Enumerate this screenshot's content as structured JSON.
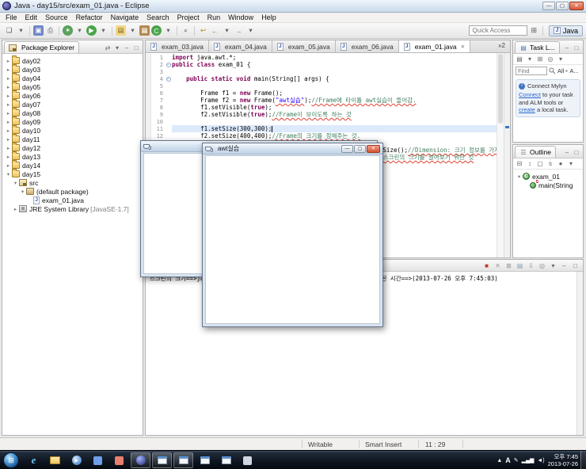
{
  "titlebar": {
    "title": "Java - day15/src/exam_01.java - Eclipse"
  },
  "menu": [
    "File",
    "Edit",
    "Source",
    "Refactor",
    "Navigate",
    "Search",
    "Project",
    "Run",
    "Window",
    "Help"
  ],
  "toolbar": {
    "quick_access_placeholder": "Quick Access",
    "perspective_label": "Java",
    "icons": [
      {
        "name": "new-wizard-icon",
        "glyph": "❏",
        "fg": "#555"
      },
      {
        "name": "new-dropdown-icon",
        "glyph": "▾",
        "fg": "#666"
      },
      {
        "sep": true
      },
      {
        "name": "save-icon",
        "glyph": "▣",
        "fg": "#fff",
        "bg": "#7186c9"
      },
      {
        "name": "print-icon",
        "glyph": "⎙",
        "fg": "#555"
      },
      {
        "sep": true
      },
      {
        "name": "debug-icon",
        "glyph": "✶",
        "fg": "#fff",
        "bg": "#5ba05b",
        "round": true
      },
      {
        "name": "debug-dropdown-icon",
        "glyph": "▾",
        "fg": "#666"
      },
      {
        "name": "run-icon",
        "glyph": "▶",
        "fg": "#fff",
        "bg": "#4aa44a",
        "round": true
      },
      {
        "name": "run-dropdown-icon",
        "glyph": "▾",
        "fg": "#666"
      },
      {
        "sep": true
      },
      {
        "name": "new-java-project-icon",
        "glyph": "▤",
        "fg": "#7a5c18",
        "bg": "#f3d787"
      },
      {
        "name": "project-dropdown-icon",
        "glyph": "▾",
        "fg": "#666"
      },
      {
        "name": "new-package-icon",
        "glyph": "▦",
        "fg": "#fff",
        "bg": "#b5894e"
      },
      {
        "name": "new-class-icon",
        "glyph": "C",
        "fg": "#fff",
        "bg": "#4aa44a",
        "round": true
      },
      {
        "name": "class-dropdown-icon",
        "glyph": "▾",
        "fg": "#666"
      },
      {
        "sep": true
      },
      {
        "name": "search-icon",
        "glyph": "⌕",
        "fg": "#444"
      },
      {
        "sep": true
      },
      {
        "name": "last-edit-icon",
        "glyph": "↩",
        "fg": "#b8860b"
      },
      {
        "name": "back-icon",
        "glyph": "←",
        "fg": "#b8860b"
      },
      {
        "name": "back-dropdown-icon",
        "glyph": "▾",
        "fg": "#666"
      },
      {
        "name": "forward-icon",
        "glyph": "→",
        "fg": "#b8860b"
      },
      {
        "name": "forward-dropdown-icon",
        "glyph": "▾",
        "fg": "#666"
      }
    ]
  },
  "package_explorer": {
    "title": "Package Explorer",
    "header_icons": [
      {
        "name": "link-with-editor-icon",
        "g": "⇄"
      },
      {
        "name": "view-menu-icon",
        "g": "▾"
      },
      {
        "name": "minimize-icon",
        "g": "–"
      },
      {
        "name": "maximize-icon",
        "g": "□"
      }
    ],
    "tree": [
      {
        "label": "day02",
        "icon": "project",
        "arrow": "right",
        "indent": 0
      },
      {
        "label": "day03",
        "icon": "project",
        "arrow": "right",
        "indent": 0
      },
      {
        "label": "day04",
        "icon": "project",
        "arrow": "right",
        "indent": 0
      },
      {
        "label": "day05",
        "icon": "project",
        "arrow": "right",
        "indent": 0
      },
      {
        "label": "day06",
        "icon": "project",
        "arrow": "right",
        "indent": 0
      },
      {
        "label": "day07",
        "icon": "project",
        "arrow": "right",
        "indent": 0
      },
      {
        "label": "day08",
        "icon": "project",
        "arrow": "right",
        "indent": 0
      },
      {
        "label": "day09",
        "icon": "project",
        "arrow": "right",
        "indent": 0
      },
      {
        "label": "day10",
        "icon": "project",
        "arrow": "right",
        "indent": 0
      },
      {
        "label": "day11",
        "icon": "project",
        "arrow": "right",
        "indent": 0
      },
      {
        "label": "day12",
        "icon": "project",
        "arrow": "right",
        "indent": 0
      },
      {
        "label": "day13",
        "icon": "project",
        "arrow": "right",
        "indent": 0
      },
      {
        "label": "day14",
        "icon": "project",
        "arrow": "right",
        "indent": 0
      },
      {
        "label": "day15",
        "icon": "project",
        "arrow": "down",
        "indent": 0
      },
      {
        "label": "src",
        "icon": "src",
        "arrow": "down",
        "indent": 1
      },
      {
        "label": "(default package)",
        "icon": "package",
        "arrow": "down",
        "indent": 2
      },
      {
        "label": "exam_01.java",
        "icon": "jfile",
        "arrow": "none",
        "indent": 3
      },
      {
        "label": "JRE System Library",
        "suffix": "[JavaSE-1.7]",
        "icon": "library",
        "arrow": "right",
        "indent": 1
      }
    ]
  },
  "editor": {
    "tabs": [
      {
        "label": "exam_03.java",
        "active": false
      },
      {
        "label": "exam_04.java",
        "active": false
      },
      {
        "label": "exam_05.java",
        "active": false
      },
      {
        "label": "exam_06.java",
        "active": false
      },
      {
        "label": "exam_01.java",
        "active": true
      }
    ],
    "overflow": "»2",
    "code": [
      {
        "n": 1,
        "seg": [
          [
            "kw",
            "import"
          ],
          [
            "pl",
            " java.awt.*;"
          ]
        ]
      },
      {
        "n": 2,
        "fold": true,
        "seg": [
          [
            "kw",
            "public"
          ],
          [
            "pl",
            " "
          ],
          [
            "kw",
            "class"
          ],
          [
            "pl",
            " exam_01 {"
          ]
        ]
      },
      {
        "n": 3,
        "seg": []
      },
      {
        "n": 4,
        "fold": true,
        "seg": [
          [
            "pl",
            "    "
          ],
          [
            "kw",
            "public"
          ],
          [
            "pl",
            " "
          ],
          [
            "kw",
            "static"
          ],
          [
            "pl",
            " "
          ],
          [
            "kw",
            "void"
          ],
          [
            "pl",
            " main(String[] args) {"
          ]
        ]
      },
      {
        "n": 5,
        "seg": []
      },
      {
        "n": 6,
        "seg": [
          [
            "pl",
            "        Frame f1 = "
          ],
          [
            "kw",
            "new"
          ],
          [
            "pl",
            " Frame();"
          ]
        ]
      },
      {
        "n": 7,
        "seg": [
          [
            "pl",
            "        Frame f2 = "
          ],
          [
            "kw",
            "new"
          ],
          [
            "pl",
            " Frame("
          ],
          [
            "strsp",
            "\"awt실습\""
          ],
          [
            "pl",
            ");"
          ],
          [
            "cmsp",
            "//Frame에 타이틀 awt실습이 들어감."
          ]
        ]
      },
      {
        "n": 8,
        "seg": [
          [
            "pl",
            "        f1.setVisible("
          ],
          [
            "kw",
            "true"
          ],
          [
            "pl",
            ");"
          ]
        ]
      },
      {
        "n": 9,
        "seg": [
          [
            "pl",
            "        f2.setVisible("
          ],
          [
            "kw",
            "true"
          ],
          [
            "pl",
            ");"
          ],
          [
            "cmsp",
            "//Frame이 보이도록 하는 것"
          ]
        ]
      },
      {
        "n": 10,
        "seg": []
      },
      {
        "n": 11,
        "highlight": true,
        "caret": true,
        "seg": [
          [
            "pl",
            "        f1.setSize(300,300);"
          ]
        ]
      },
      {
        "n": 12,
        "seg": [
          [
            "pl",
            "        f2.setSize(400,400);"
          ],
          [
            "cmsp",
            "//Frame의 크기를 정해주는 것."
          ]
        ]
      },
      {
        "n": 13,
        "seg": []
      },
      {
        "n": 14,
        "seg": [
          [
            "pl",
            "        Dimension d = Toolkit.getDefaultToolkit().getScreenSize();"
          ],
          [
            "cmsp",
            "//Dimension: 크기 정보를 가지고 있는 클래스, 이"
          ]
        ]
      },
      {
        "n": 15,
        "seg": [
          [
            "pl",
            "                                                     "
          ],
          [
            "cmsp",
            "//경우 스크린의 크기를 알아보기 위한 것"
          ]
        ]
      }
    ]
  },
  "console": {
    "output": "스크린의 크기==>java.awt.Dimension[width=1024,height=768] main이 시작된 시간==>(2013-07-26 오후 7:45:03)",
    "icons": [
      {
        "name": "terminate-icon",
        "g": "■",
        "c": "#c0392b"
      },
      {
        "name": "remove-launch-icon",
        "g": "✕",
        "c": "#999999"
      },
      {
        "name": "remove-all-icon",
        "g": "⊠",
        "c": "#999999"
      },
      {
        "name": "clear-console-icon",
        "g": "▤",
        "c": "#88a0b8"
      },
      {
        "name": "scroll-lock-icon",
        "g": "⇩",
        "c": "#888888"
      },
      {
        "name": "pin-console-icon",
        "g": "◎",
        "c": "#888888"
      },
      {
        "name": "open-console-dropdown-icon",
        "g": "▾",
        "c": "#666666"
      },
      {
        "name": "minimize-icon",
        "g": "–",
        "c": "#666666"
      },
      {
        "name": "maximize-icon",
        "g": "□",
        "c": "#666666"
      }
    ]
  },
  "task_list": {
    "title": "Task L...",
    "header_icons": [
      {
        "name": "minimize-icon",
        "g": "–"
      },
      {
        "name": "maximize-icon",
        "g": "□"
      }
    ],
    "tools": [
      {
        "name": "new-task-icon",
        "g": "▤"
      },
      {
        "name": "new-task-dropdown-icon",
        "g": "▾"
      },
      {
        "name": "categorized-icon",
        "g": "⊞"
      },
      {
        "name": "focus-icon",
        "g": "◎"
      },
      {
        "name": "view-menu-icon",
        "g": "▾"
      }
    ],
    "find_placeholder": "Find",
    "scope_all": "All",
    "scope_more": "A...",
    "mylyn": {
      "title": "Connect Mylyn",
      "parts": [
        {
          "t": "Connect",
          "link": true
        },
        {
          "t": " to your task and ALM tools or ",
          "link": false
        },
        {
          "t": "create",
          "link": true
        },
        {
          "t": " a local task.",
          "link": false
        }
      ]
    }
  },
  "outline": {
    "title": "Outline",
    "header_icons": [
      {
        "name": "minimize-icon",
        "g": "–"
      },
      {
        "name": "maximize-icon",
        "g": "□"
      }
    ],
    "tools": [
      {
        "name": "collapse-all-icon",
        "g": "⊟"
      },
      {
        "name": "sort-icon",
        "g": "↕"
      },
      {
        "name": "hide-fields-icon",
        "g": "▢"
      },
      {
        "name": "hide-static-icon",
        "g": "s"
      },
      {
        "name": "hide-non-public-icon",
        "g": "●"
      },
      {
        "name": "view-menu-icon",
        "g": "▾"
      }
    ],
    "items": [
      {
        "label": "exam_01",
        "icon": "class",
        "arrow": "down",
        "indent": 0
      },
      {
        "label": "main(String",
        "icon": "method-static",
        "arrow": "none",
        "indent": 1
      }
    ]
  },
  "statusbar": {
    "writable": "Writable",
    "insert_mode": "Smart Insert",
    "position": "11 : 29"
  },
  "awt": {
    "frame1_title": "",
    "frame2_title": "awt실습"
  },
  "taskbar": {
    "clock_time": "오후 7:45",
    "clock_date": "2013-07-26",
    "buttons": [
      {
        "name": "internet-explorer-button",
        "kind": "ie",
        "g": "e",
        "open": false
      },
      {
        "name": "windows-explorer-button",
        "kind": "folder",
        "open": false
      },
      {
        "name": "media-player-button",
        "kind": "media",
        "g": "▶",
        "open": false
      },
      {
        "name": "app-blue-button",
        "kind": "box",
        "fg": "#6f9fe8",
        "open": false
      },
      {
        "name": "app-red-button",
        "kind": "box",
        "fg": "#e87f6f",
        "open": false
      },
      {
        "name": "eclipse-button",
        "kind": "eclipse",
        "open": true
      },
      {
        "name": "java-frame-button-1",
        "kind": "win",
        "open": true
      },
      {
        "name": "java-frame-button-2",
        "kind": "win",
        "open": true
      },
      {
        "name": "java-frame-button-3",
        "kind": "win",
        "open": false
      },
      {
        "name": "java-frame-button-4",
        "kind": "win",
        "open": false
      },
      {
        "name": "notepad-button",
        "kind": "box",
        "fg": "#cfd8e0",
        "open": false
      }
    ],
    "tray": [
      {
        "name": "show-hidden-icons",
        "g": "▲"
      },
      {
        "name": "ime-korean",
        "g": "A",
        "ime": true
      },
      {
        "name": "ime-pen",
        "g": "✎"
      },
      {
        "name": "network",
        "g": "▂▄▆"
      },
      {
        "name": "volume",
        "g": "◄)"
      }
    ]
  }
}
